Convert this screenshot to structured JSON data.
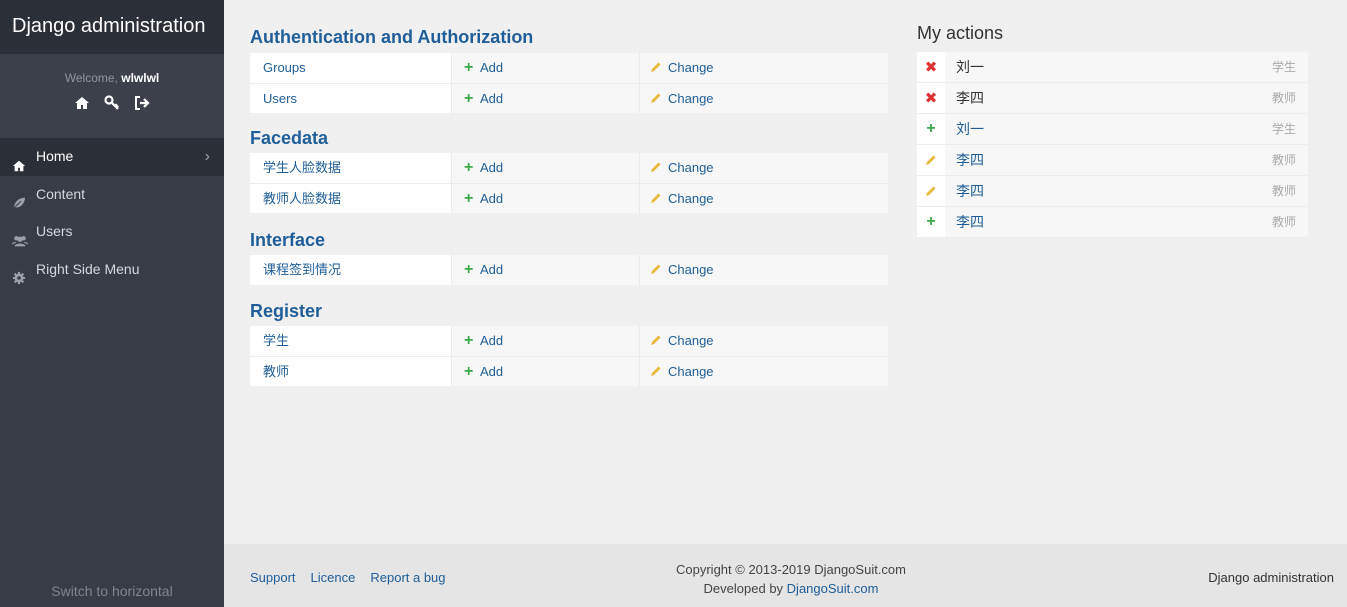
{
  "sidebar": {
    "brand": "Django administration",
    "welcome_prefix": "Welcome,",
    "username": "wlwlwl",
    "nav": [
      {
        "label": "Home",
        "icon": "home-icon",
        "active": true
      },
      {
        "label": "Content",
        "icon": "leaf-icon",
        "active": false
      },
      {
        "label": "Users",
        "icon": "users-icon",
        "active": false
      },
      {
        "label": "Right Side Menu",
        "icon": "gear-icon",
        "active": false
      }
    ],
    "switch_label": "Switch to horizontal"
  },
  "modules": [
    {
      "title": "Authentication and Authorization",
      "rows": [
        {
          "name": "Groups"
        },
        {
          "name": "Users"
        }
      ]
    },
    {
      "title": "Facedata",
      "rows": [
        {
          "name": "学生人脸数据"
        },
        {
          "name": "教师人脸数据"
        }
      ]
    },
    {
      "title": "Interface",
      "rows": [
        {
          "name": "课程签到情况"
        }
      ]
    },
    {
      "title": "Register",
      "rows": [
        {
          "name": "学生"
        },
        {
          "name": "教师"
        }
      ]
    }
  ],
  "labels": {
    "add": "Add",
    "change": "Change"
  },
  "actions": {
    "title": "My actions",
    "items": [
      {
        "type": "delete",
        "name": "刘一",
        "model": "学生"
      },
      {
        "type": "delete",
        "name": "李四",
        "model": "教师"
      },
      {
        "type": "add",
        "name": "刘一",
        "model": "学生"
      },
      {
        "type": "change",
        "name": "李四",
        "model": "教师"
      },
      {
        "type": "change",
        "name": "李四",
        "model": "教师"
      },
      {
        "type": "add",
        "name": "李四",
        "model": "教师"
      }
    ]
  },
  "footer": {
    "links": [
      "Support",
      "Licence",
      "Report a bug"
    ],
    "copyright_line1": "Copyright © 2013-2019 DjangoSuit.com",
    "developed_prefix": "Developed by ",
    "developed_link": "DjangoSuit.com",
    "right": "Django administration"
  },
  "colors": {
    "link": "#1f5e98",
    "sidebar": "#373c47",
    "add": "#3aaa4a",
    "delete": "#d33333",
    "change": "#e8b93a"
  }
}
